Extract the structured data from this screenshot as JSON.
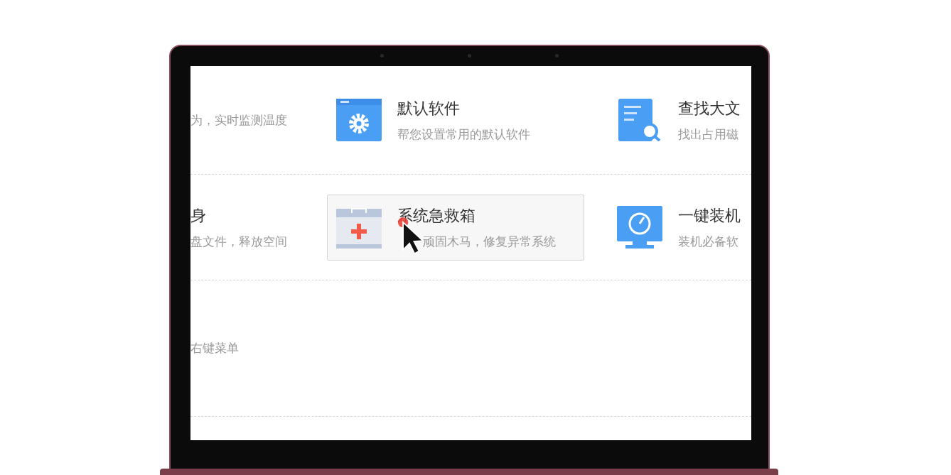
{
  "rows": [
    {
      "items": [
        {
          "kind": "clipped",
          "description": "为，实时监测温度"
        },
        {
          "kind": "tool",
          "title": "默认软件",
          "description": "帮您设置常用的默认软件",
          "hovered": false
        },
        {
          "kind": "tool",
          "title": "查找大文",
          "description": "找出占用磁",
          "hovered": false
        }
      ]
    },
    {
      "items": [
        {
          "kind": "clipped",
          "title": "身",
          "description": "盘文件，释放空间"
        },
        {
          "kind": "tool",
          "title": "系统急救箱",
          "description": "顽固木马，修复异常系统",
          "hovered": true
        },
        {
          "kind": "tool",
          "title": "一键装机",
          "description": "装机必备软",
          "hovered": false
        }
      ]
    },
    {
      "items": [
        {
          "kind": "clipped",
          "description": "右键菜单"
        }
      ]
    }
  ]
}
